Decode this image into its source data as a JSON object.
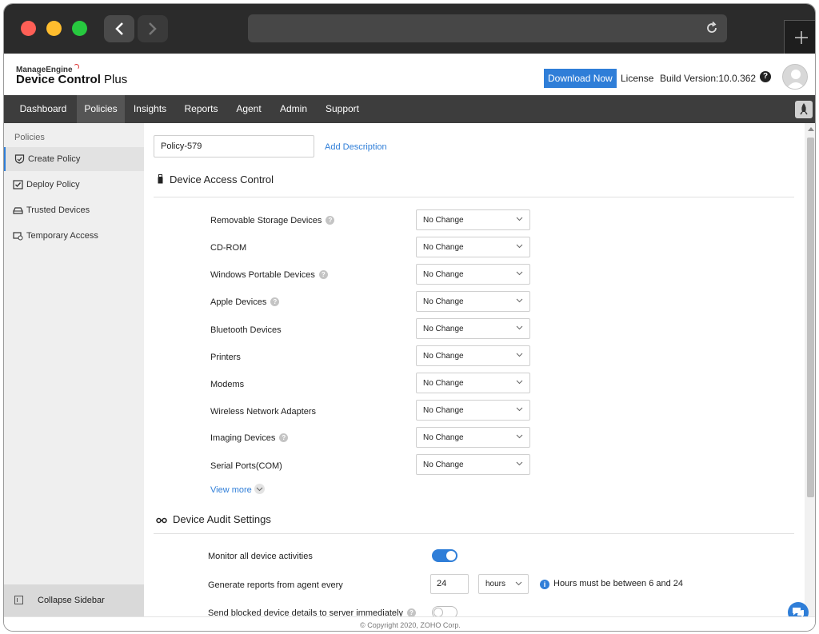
{
  "header": {
    "brand_small": "ManageEngine",
    "brand_main": "Device Control",
    "brand_suffix": " Plus",
    "download_label": "Download Now",
    "license_label": "License",
    "build_version": "Build Version:10.0.362",
    "help_label": "?"
  },
  "nav": {
    "items": [
      "Dashboard",
      "Policies",
      "Insights",
      "Reports",
      "Agent",
      "Admin",
      "Support"
    ],
    "active": "Policies"
  },
  "sidebar": {
    "title": "Policies",
    "items": [
      "Create Policy",
      "Deploy Policy",
      "Trusted Devices",
      "Temporary Access"
    ],
    "active": "Create Policy",
    "collapse_label": "Collapse Sidebar"
  },
  "policy": {
    "name": "Policy-579",
    "add_description": "Add Description"
  },
  "access_control": {
    "title": "Device Access Control",
    "rows": [
      {
        "label": "Removable Storage Devices",
        "help": true,
        "value": "No Change"
      },
      {
        "label": "CD-ROM",
        "help": false,
        "value": "No Change"
      },
      {
        "label": "Windows Portable Devices",
        "help": true,
        "value": "No Change"
      },
      {
        "label": "Apple Devices",
        "help": true,
        "value": "No Change"
      },
      {
        "label": "Bluetooth Devices",
        "help": false,
        "value": "No Change"
      },
      {
        "label": "Printers",
        "help": false,
        "value": "No Change"
      },
      {
        "label": "Modems",
        "help": false,
        "value": "No Change"
      },
      {
        "label": "Wireless Network Adapters",
        "help": false,
        "value": "No Change"
      },
      {
        "label": "Imaging Devices",
        "help": true,
        "value": "No Change"
      },
      {
        "label": "Serial Ports(COM)",
        "help": false,
        "value": "No Change"
      }
    ],
    "view_more": "View more"
  },
  "audit": {
    "title": "Device Audit Settings",
    "monitor_label": "Monitor all device activities",
    "monitor_on": true,
    "reports_label": "Generate reports from agent every",
    "reports_value": "24",
    "reports_unit": "hours",
    "reports_info": "Hours must be between 6 and 24",
    "blocked_label": "Send blocked device details to server immediately",
    "blocked_on": false
  },
  "footer": {
    "copyright": "© Copyright 2020, ZOHO Corp."
  },
  "colors": {
    "accent": "#2f7ed8",
    "nav_bg": "#3d3d3d",
    "sidebar_bg": "#efefef"
  }
}
